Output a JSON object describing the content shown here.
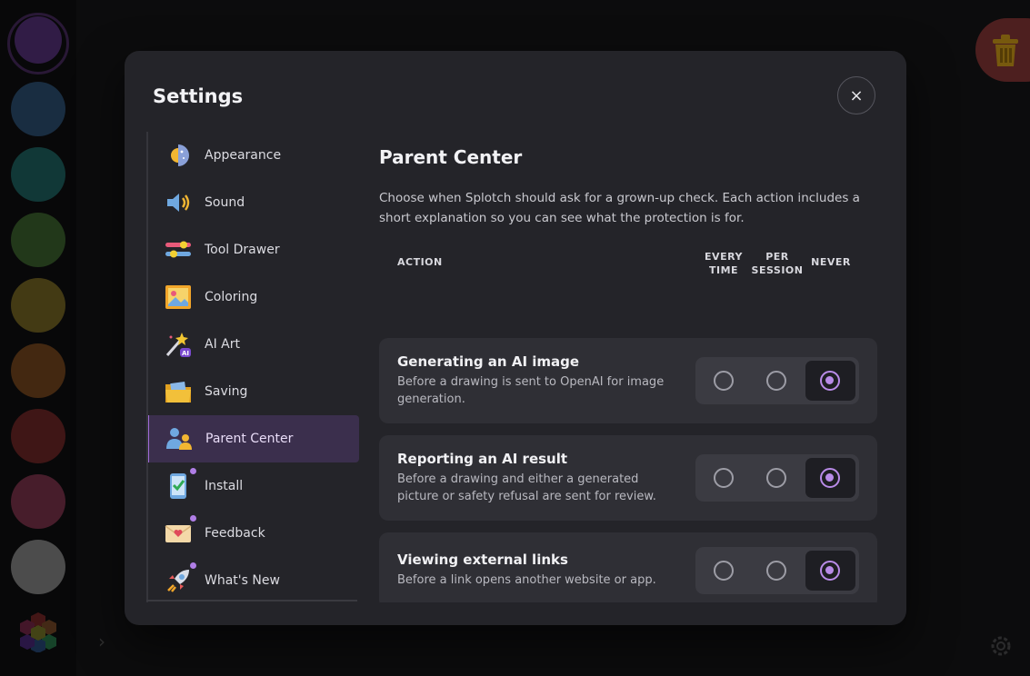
{
  "palette": {
    "colors": [
      "#5a3480",
      "#2f5277",
      "#1f6764",
      "#3f6630",
      "#7a6a26",
      "#7a4a1f",
      "#742828",
      "#82354f",
      "#8a8a8a"
    ]
  },
  "modal": {
    "title": "Settings",
    "close_icon": "×"
  },
  "nav": {
    "items": [
      {
        "label": "Appearance",
        "icon": "sun-moon-icon"
      },
      {
        "label": "Sound",
        "icon": "speaker-icon"
      },
      {
        "label": "Tool Drawer",
        "icon": "sliders-icon"
      },
      {
        "label": "Coloring",
        "icon": "picture-icon"
      },
      {
        "label": "AI Art",
        "icon": "magic-wand-icon"
      },
      {
        "label": "Saving",
        "icon": "folder-icon"
      },
      {
        "label": "Parent Center",
        "icon": "parent-child-icon"
      },
      {
        "label": "Install",
        "icon": "phone-check-icon"
      },
      {
        "label": "Feedback",
        "icon": "envelope-heart-icon"
      },
      {
        "label": "What's New",
        "icon": "rocket-icon"
      }
    ],
    "active_index": 6
  },
  "content": {
    "title": "Parent Center",
    "description": "Choose when Splotch should ask for a grown-up check. Each action includes a short explanation so you can see what the protection is for.",
    "columns": {
      "action": "ACTION",
      "every_time_1": "EVERY",
      "every_time_2": "TIME",
      "per_session_1": "PER",
      "per_session_2": "SESSION",
      "never": "NEVER"
    },
    "rows": [
      {
        "title": "Generating an AI image",
        "desc_1": "Before a drawing is sent to OpenAI for image",
        "desc_2": "generation.",
        "selected": "never"
      },
      {
        "title": "Reporting an AI result",
        "desc_1": "Before a drawing and either a generated",
        "desc_2": "picture or safety refusal are sent for review.",
        "selected": "never"
      },
      {
        "title": "Viewing external links",
        "desc_1": "Before a link opens another website or app.",
        "desc_2": "",
        "selected": "never"
      }
    ]
  },
  "colors": {
    "accent": "#b98be8",
    "active_nav_bg": "#3b2f4d",
    "trash_bg": "#8c3a3a"
  }
}
